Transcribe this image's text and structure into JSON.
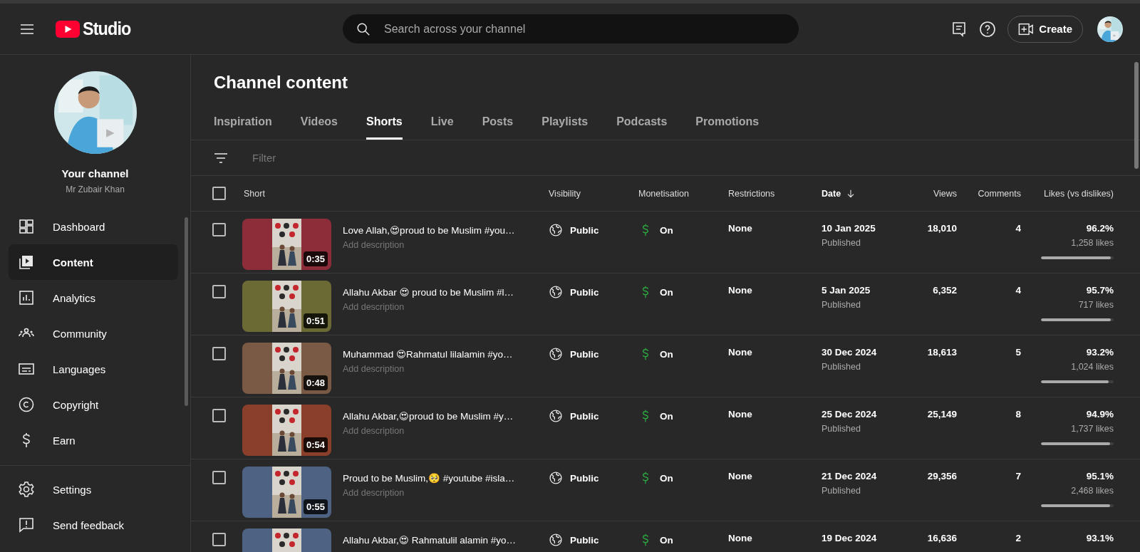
{
  "header": {
    "logo_text": "Studio",
    "search": {
      "placeholder": "Search across your channel"
    },
    "create_label": "Create"
  },
  "sidebar": {
    "channel_title": "Your channel",
    "channel_name": "Mr Zubair Khan",
    "items": [
      {
        "kind": "dashboard",
        "label": "Dashboard",
        "selected": false
      },
      {
        "kind": "content",
        "label": "Content",
        "selected": true
      },
      {
        "kind": "analytics",
        "label": "Analytics",
        "selected": false
      },
      {
        "kind": "community",
        "label": "Community",
        "selected": false
      },
      {
        "kind": "languages",
        "label": "Languages",
        "selected": false
      },
      {
        "kind": "copyright",
        "label": "Copyright",
        "selected": false
      },
      {
        "kind": "earn",
        "label": "Earn",
        "selected": false
      }
    ],
    "footer_items": [
      {
        "kind": "settings",
        "label": "Settings",
        "selected": false
      },
      {
        "kind": "feedback",
        "label": "Send feedback",
        "selected": false
      }
    ]
  },
  "page_title": "Channel content",
  "tabs": [
    {
      "label": "Inspiration",
      "selected": false
    },
    {
      "label": "Videos",
      "selected": false
    },
    {
      "label": "Shorts",
      "selected": true
    },
    {
      "label": "Live",
      "selected": false
    },
    {
      "label": "Posts",
      "selected": false
    },
    {
      "label": "Playlists",
      "selected": false
    },
    {
      "label": "Podcasts",
      "selected": false
    },
    {
      "label": "Promotions",
      "selected": false
    }
  ],
  "filter": {
    "placeholder": "Filter"
  },
  "table": {
    "select_all_checked": false,
    "columns": [
      {
        "label": "Short",
        "sorted": false
      },
      {
        "label": "Visibility",
        "sorted": false
      },
      {
        "label": "Monetisation",
        "sorted": false
      },
      {
        "label": "Restrictions",
        "sorted": false
      },
      {
        "label": "Date",
        "sorted": true
      },
      {
        "label": "Views",
        "sorted": false
      },
      {
        "label": "Comments",
        "sorted": false
      },
      {
        "label": "Likes (vs dislikes)",
        "sorted": false
      }
    ],
    "rows": [
      {
        "checked": false,
        "duration": "0:35",
        "title": "Love Allah,😍proud to be Muslim #you…",
        "description": "Add description",
        "visibility": "Public",
        "monetisation": "On",
        "restrictions": "None",
        "date": "10 Jan 2025",
        "date_status": "Published",
        "views": "18,010",
        "comments": "4",
        "likes_percent": "96.2%",
        "likes_count": "1,258 likes",
        "level": 0.962
      },
      {
        "checked": false,
        "duration": "0:51",
        "title": "Allahu Akbar 😍 proud to be Muslim #l…",
        "description": "Add description",
        "visibility": "Public",
        "monetisation": "On",
        "restrictions": "None",
        "date": "5 Jan 2025",
        "date_status": "Published",
        "views": "6,352",
        "comments": "4",
        "likes_percent": "95.7%",
        "likes_count": "717 likes",
        "level": 0.957
      },
      {
        "checked": false,
        "duration": "0:48",
        "title": "Muhammad 😍Rahmatul lilalamin #yo…",
        "description": "Add description",
        "visibility": "Public",
        "monetisation": "On",
        "restrictions": "None",
        "date": "30 Dec 2024",
        "date_status": "Published",
        "views": "18,613",
        "comments": "5",
        "likes_percent": "93.2%",
        "likes_count": "1,024 likes",
        "level": 0.932
      },
      {
        "checked": false,
        "duration": "0:54",
        "title": "Allahu Akbar,😍proud to be Muslim #y…",
        "description": "Add description",
        "visibility": "Public",
        "monetisation": "On",
        "restrictions": "None",
        "date": "25 Dec 2024",
        "date_status": "Published",
        "views": "25,149",
        "comments": "8",
        "likes_percent": "94.9%",
        "likes_count": "1,737 likes",
        "level": 0.949
      },
      {
        "checked": false,
        "duration": "0:55",
        "title": "Proud to be Muslim,🥺 #youtube #isla…",
        "description": "Add description",
        "visibility": "Public",
        "monetisation": "On",
        "restrictions": "None",
        "date": "21 Dec 2024",
        "date_status": "Published",
        "views": "29,356",
        "comments": "7",
        "likes_percent": "95.1%",
        "likes_count": "2,468 likes",
        "level": 0.951
      },
      {
        "checked": false,
        "title": "Allahu Akbar,😍 Rahmatulil alamin #yo…",
        "visibility": "Public",
        "monetisation": "On",
        "restrictions": "None",
        "date": "19 Dec 2024",
        "views": "16,636",
        "comments": "2",
        "likes_percent": "93.1%"
      }
    ]
  }
}
